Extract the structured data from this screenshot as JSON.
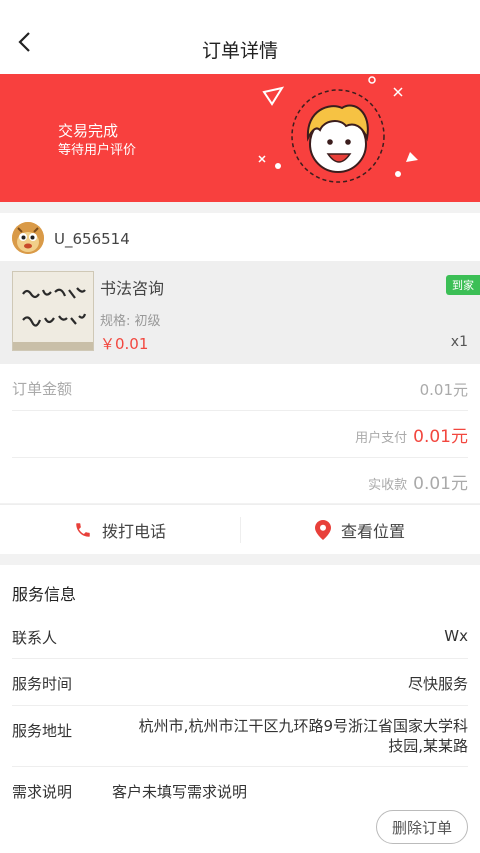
{
  "header": {
    "title": "订单详情"
  },
  "banner": {
    "status": "交易完成",
    "subtitle": "等待用户评价",
    "accent_color": "#f8403e"
  },
  "order": {
    "username": "U_656514",
    "product": {
      "name": "书法咨询",
      "spec": "规格: 初级",
      "price": "￥0.01",
      "quantity": "x1",
      "tag": "到家"
    },
    "amount_label": "订单金额",
    "amount_value": "0.01元",
    "user_paid_label": "用户支付",
    "user_paid_value": "0.01元",
    "received_label": "实收款",
    "received_value": "0.01元"
  },
  "actions": {
    "call_label": "拨打电话",
    "location_label": "查看位置"
  },
  "service": {
    "title": "服务信息",
    "rows": [
      {
        "label": "联系人",
        "value": "Wx"
      },
      {
        "label": "服务时间",
        "value": "尽快服务"
      },
      {
        "label": "服务地址",
        "value_line1": "杭州市,杭州市江干区九环路9号浙江省国家大学科",
        "value_line2": "技园,某某路"
      },
      {
        "label": "需求说明",
        "value": "客户未填写需求说明"
      }
    ]
  },
  "footer": {
    "delete_label": "删除订单"
  }
}
